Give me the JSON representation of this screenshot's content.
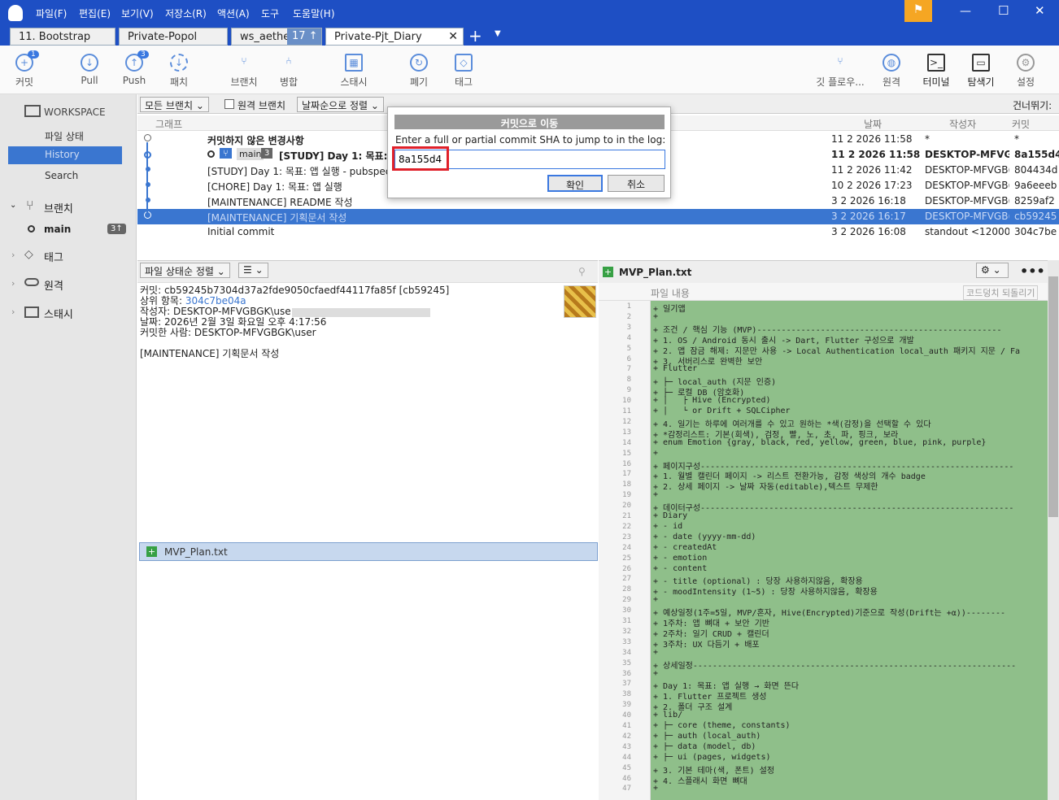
{
  "menu": [
    "파일(F)",
    "편집(E)",
    "보기(V)",
    "저장소(R)",
    "액션(A)",
    "도구",
    "도움말(H)"
  ],
  "tabs": [
    "11. Bootstrap",
    "Private-Popol",
    "ws_aether",
    "Private-Pjt_Diary"
  ],
  "tab_badge": "17 ↑",
  "toolbar": {
    "commit": "커밋",
    "commit_badge": "1",
    "pull": "Pull",
    "push": "Push",
    "push_badge": "3",
    "fetch": "패치",
    "branch": "브랜치",
    "merge": "병합",
    "stash": "스태시",
    "discard": "폐기",
    "tag": "태그",
    "gitflow": "깃 플로우...",
    "remote": "원격",
    "terminal": "터미널",
    "explorer": "탐색기",
    "settings": "설정"
  },
  "sidebar": {
    "workspace": "WORKSPACE",
    "file_status": "파일 상태",
    "history": "History",
    "search": "Search",
    "branches": "브랜치",
    "main": "main",
    "main_badge": "3↑",
    "tags": "태그",
    "remotes": "원격",
    "stashes": "스태시"
  },
  "loghead": {
    "all_branches": "모든 브랜치",
    "remote_branches": "원격 브랜치",
    "sort": "날짜순으로 정렬",
    "skip": "건너뛰기:"
  },
  "columns": {
    "graph": "그래프",
    "date": "날짜",
    "author": "작성자",
    "commit": "커밋"
  },
  "commits": [
    {
      "msg": "커밋하지 않은 변경사항",
      "date": "11 2 2026 11:58",
      "author": "*",
      "hash": "*"
    },
    {
      "msg": "[STUDY] Day 1: 목표: 앱",
      "branch": "main",
      "count": "3",
      "date": "11 2 2026 11:58",
      "author": "DESKTOP-MFVGE",
      "hash": "8a155d4"
    },
    {
      "msg": "[STUDY] Day 1: 목표: 앱 실행 - pubspec.",
      "date": "11 2 2026 11:42",
      "author": "DESKTOP-MFVGB(",
      "hash": "804434d"
    },
    {
      "msg": "[CHORE] Day 1: 목표: 앱 실행",
      "date": "10 2 2026 17:23",
      "author": "DESKTOP-MFVGB(",
      "hash": "9a6eeeb"
    },
    {
      "msg": "[MAINTENANCE] README 작성",
      "date": "3 2 2026 16:18",
      "author": "DESKTOP-MFVGB(",
      "hash": "8259af2"
    },
    {
      "msg": "[MAINTENANCE] 기획문서 작성",
      "date": "3 2 2026 16:17",
      "author": "DESKTOP-MFVGB(",
      "hash": "cb59245"
    },
    {
      "msg": "Initial commit",
      "date": "3 2 2026 16:08",
      "author": "standout <12000(",
      "hash": "304c7be"
    }
  ],
  "detail": {
    "sort": "파일 상태순 정렬",
    "commit": "커밋: cb59245b7304d37a2fde9050cfaedf44117fa85f [cb59245]",
    "parent_label": "상위 항목:",
    "parent": "304c7be04a",
    "author": "작성자: DESKTOP-MFVGBGK\\use",
    "date": "날짜: 2026년 2월 3일 화요일 오후 4:17:56",
    "committer_label": "커밋한 사람:",
    "committer": "DESKTOP-MFVGBGK\\user",
    "message": "[MAINTENANCE] 기획문서 작성",
    "file": "MVP_Plan.txt"
  },
  "diff": {
    "file": "MVP_Plan.txt",
    "sub": "파일 내용",
    "revert": "코드덩치 되돌리기",
    "lines": [
      "+ 일기앱",
      "+",
      "+ 조건 / 핵심 기능 (MVP)--------------------------------------------------",
      "+ 1. OS / Android 동시 출시 -> Dart, Flutter 구성으로 개발",
      "+ 2. 앱 잠금 해제: 지문만 사용 -> Local Authentication local_auth 패키지 지문 / Fa",
      "+ 3. 서버리스로 완벽한 보안",
      "+ Flutter",
      "+ ├─ local_auth (지문 인증)",
      "+ ├─ 로컬 DB (암호화)",
      "+ │   ├ Hive (Encrypted)",
      "+ │   └ or Drift + SQLCipher",
      "+ 4. 일기는 하루에 여러개를 수 있고 원하는 *색(감정)을 선택할 수 있다",
      "+ *감정리스트: 기본(회색), 검정, 빨, 노, 초, 파, 핑크, 보라",
      "+ enum Emotion {gray, black, red, yellow, green, blue, pink, purple}",
      "+",
      "+ 페이지구성----------------------------------------------------------------",
      "+ 1. 월별 캘린더 페이지 -> 리스트 전환가능, 감정 색상의 개수 badge",
      "+ 2. 상세 페이지 -> 날짜 자동(editable),텍스트 무제한",
      "+",
      "+ 데이터구성----------------------------------------------------------------",
      "+ Diary",
      "+ - id",
      "+ - date (yyyy-mm-dd)",
      "+ - createdAt",
      "+ - emotion",
      "+ - content",
      "+ - title (optional) : 당장 사용하지않음, 확장용",
      "+ - moodIntensity (1~5) : 당장 사용하지않음, 확장용",
      "+",
      "+ 예상일정(1주=5일, MVP/혼자, Hive(Encrypted)기준으로 작성(Drift는 +α))--------",
      "+ 1주차: 앱 뼈대 + 보안 기반",
      "+ 2주차: 일기 CRUD + 캘린더",
      "+ 3주차: UX 다듬기 + 배포",
      "+",
      "+ 상세일정------------------------------------------------------------------",
      "+",
      "+ Day 1: 목표: 앱 실행 → 화면 뜬다",
      "+ 1. Flutter 프로젝트 생성",
      "+ 2. 폴더 구조 설계",
      "+ lib/",
      "+ ├─ core (theme, constants)",
      "+ ├─ auth (local_auth)",
      "+ ├─ data (model, db)",
      "+ ├─ ui (pages, widgets)",
      "+ 3. 기본 테마(색, 폰트) 설정",
      "+ 4. 스플래시 화면 뼈대",
      "+"
    ]
  },
  "dialog": {
    "title": "커밋으로 이동",
    "prompt": "Enter a full or partial commit SHA to jump to in the log:",
    "value": "8a155d4",
    "ok": "확인",
    "cancel": "취소"
  }
}
